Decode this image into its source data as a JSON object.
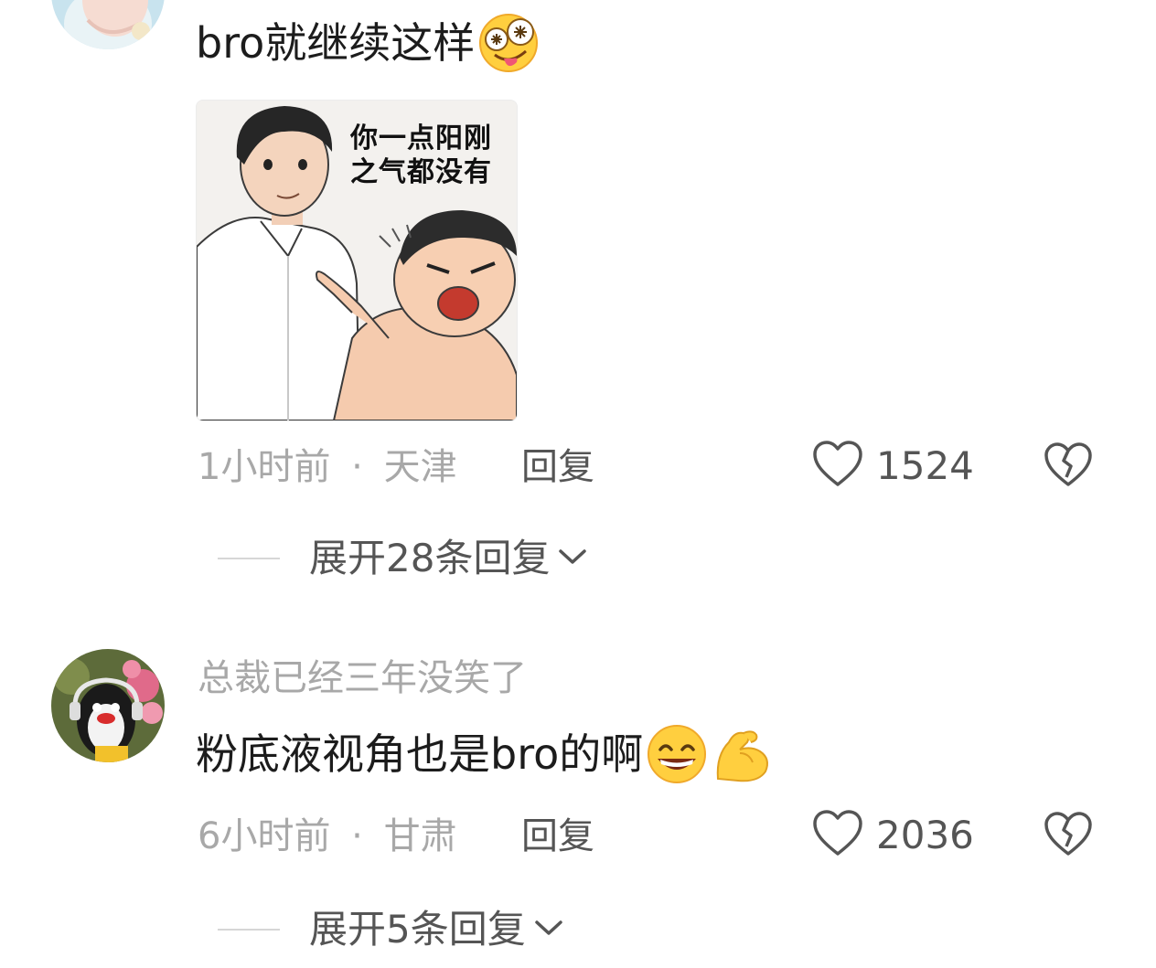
{
  "comments": [
    {
      "text": "bro就继续这样",
      "emoji": "zany-face-icon",
      "time": "1小时前",
      "separator": "·",
      "location": "天津",
      "reply_label": "回复",
      "likes": "1524",
      "image": {
        "caption_line1": "你一点阳刚",
        "caption_line2": "之气都没有"
      },
      "expand_label": "展开28条回复"
    },
    {
      "username": "总裁已经三年没笑了",
      "text": "粉底液视角也是bro的啊",
      "emojis": [
        "grinning-face-icon",
        "flexed-biceps-icon"
      ],
      "time": "6小时前",
      "separator": "·",
      "location": "甘肃",
      "reply_label": "回复",
      "likes": "2036",
      "expand_label": "展开5条回复"
    }
  ],
  "colors": {
    "text_primary": "#1c1c1c",
    "text_secondary": "#a8a8a8",
    "text_action": "#555555",
    "divider": "#d6d6d6"
  }
}
